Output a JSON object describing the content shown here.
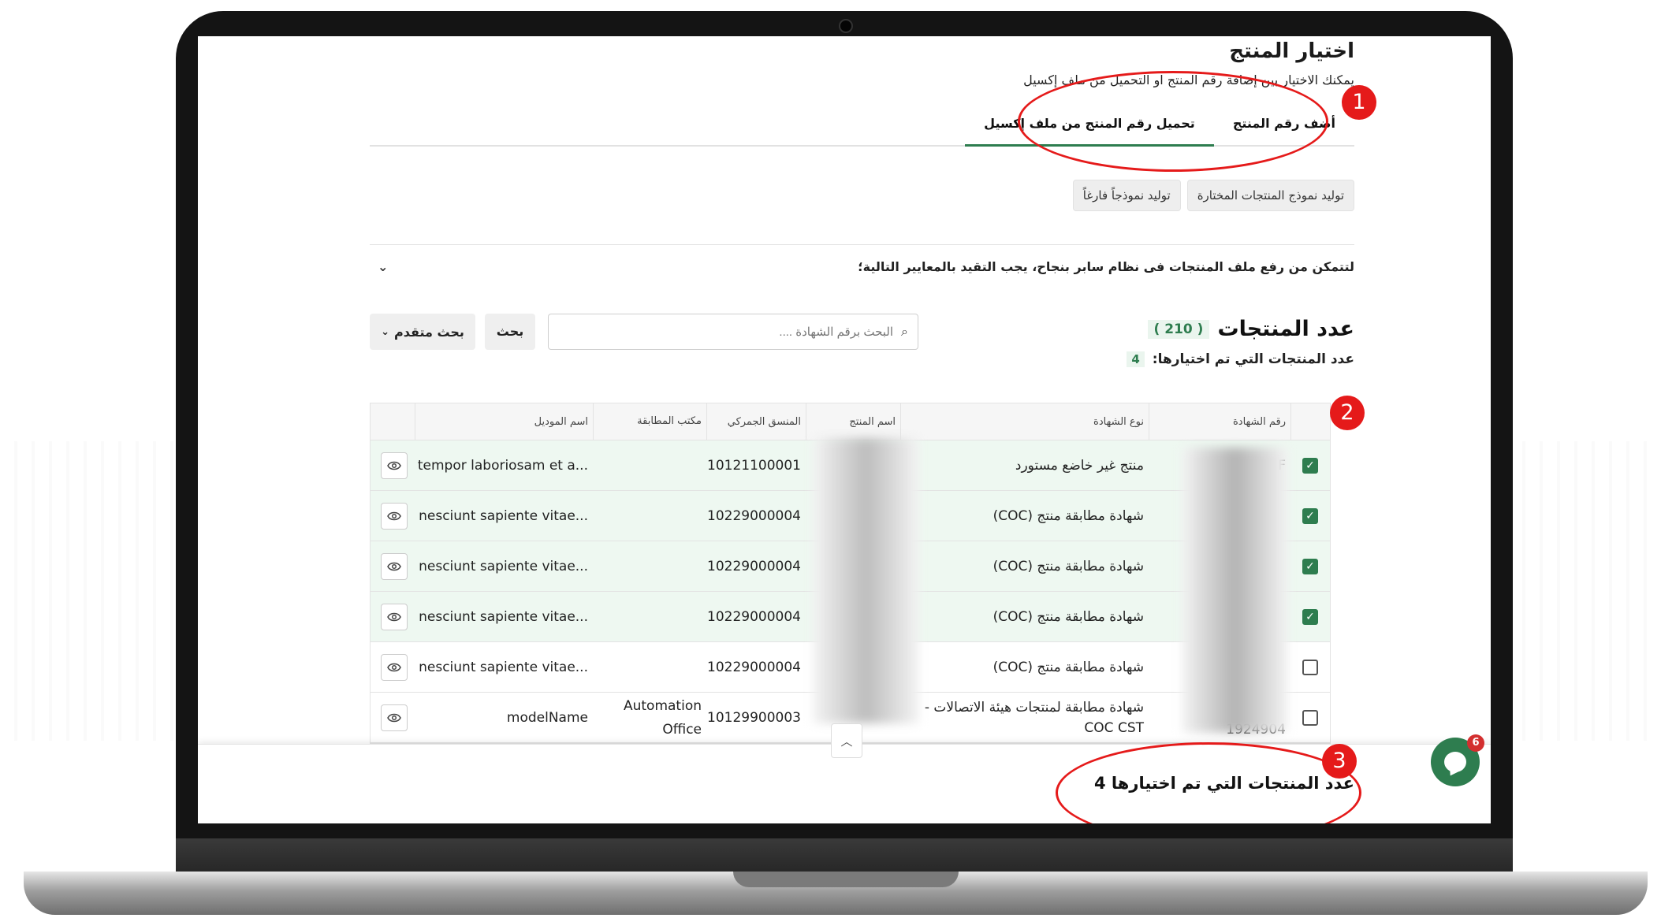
{
  "page": {
    "title": "اختيار المنتج",
    "subtitle": "يمكنك الاختيار بين إضافة رقم المنتج او التحميل من ملف إكسيل"
  },
  "tabs": [
    {
      "label": "أضف رقم المنتج",
      "active": false
    },
    {
      "label": "تحميل رقم المنتج من ملف إكسيل",
      "active": true
    }
  ],
  "generate": {
    "selected_label": "توليد نموذج المنتجات المختارة",
    "empty_label": "توليد نموذجاً فارغاً"
  },
  "criteria": {
    "text": "لتتمكن من رفع ملف المنتجات فى نظام سابر بنجاح، يجب التقيد بالمعايير التالية؛",
    "icon": "chevron-down-icon"
  },
  "products": {
    "count_label": "عدد المنتجات",
    "count_value": "( 210 )",
    "selected_label": "عدد المنتجات التي تم اختيارها:",
    "selected_value": "4"
  },
  "search": {
    "placeholder": "البحث برقم الشهادة ....",
    "search_button": "بحث",
    "advanced_button": "بحث متقدم"
  },
  "table": {
    "headers": [
      "رقم الشهادة",
      "نوع الشهادة",
      "اسم المنتج",
      "المنسق الجمركي",
      "مكتب المطابقة",
      "اسم الموديل"
    ],
    "rows": [
      {
        "checked": true,
        "cert_no": "F",
        "cert_type": "منتج غير خاضع مستورد",
        "product": "",
        "hs_code": "010121100001",
        "office": "",
        "model": "...re tempor laboriosam et a"
      },
      {
        "checked": true,
        "cert_no": "",
        "cert_type": "شهادة مطابقة منتج (COC)",
        "product": "",
        "hs_code": "010229000004",
        "office": "",
        "model": "...is nesciunt sapiente vitae"
      },
      {
        "checked": true,
        "cert_no": "",
        "cert_type": "شهادة مطابقة منتج (COC)",
        "product": "",
        "hs_code": "010229000004",
        "office": "",
        "model": "...is nesciunt sapiente vitae"
      },
      {
        "checked": true,
        "cert_no": "",
        "cert_type": "شهادة مطابقة منتج (COC)",
        "product": "",
        "hs_code": "010229000004",
        "office": "",
        "model": "...is nesciunt sapiente vitae"
      },
      {
        "checked": false,
        "cert_no": "",
        "cert_type": "شهادة مطابقة منتج (COC)",
        "product": "",
        "hs_code": "010229000004",
        "office": "",
        "model": "...is nesciunt sapiente vitae"
      },
      {
        "checked": false,
        "cert_no": "1924904",
        "cert_type": "شهادة مطابقة لمنتجات هيئة الاتصالات -COC CST",
        "product": "",
        "hs_code": "010129900003",
        "office": "Automation Office",
        "model": "modelName"
      }
    ]
  },
  "footer": {
    "selected_text": "عدد المنتجات التي تم اختيارها 4"
  },
  "chat": {
    "badge": "6"
  },
  "annotations": [
    "1",
    "2",
    "3"
  ],
  "colors": {
    "accent": "#2e7d4f",
    "annotation": "#e51a1a",
    "selected_row": "#eef8f1"
  }
}
